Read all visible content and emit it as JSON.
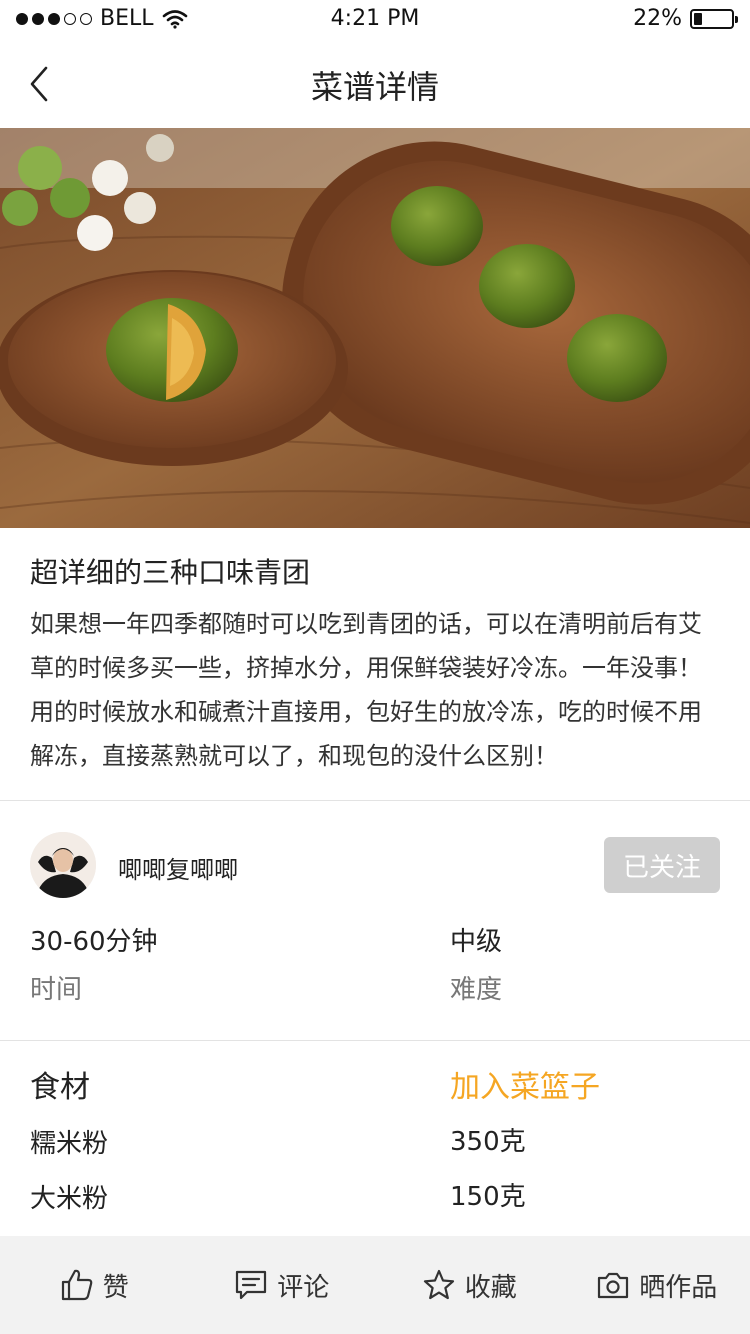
{
  "status_bar": {
    "carrier": "BELL",
    "time": "4:21 PM",
    "battery_percent": "22%",
    "battery_level": 0.22,
    "signal_filled": 3,
    "signal_total": 5
  },
  "navbar": {
    "title": "菜谱详情",
    "back_icon": "chevron-left-icon"
  },
  "recipe": {
    "title": "超详细的三种口味青团",
    "description": "如果想一年四季都随时可以吃到青团的话，可以在清明前后有艾草的时候多买一些，挤掉水分，用保鲜袋装好冷冻。一年没事！用的时候放水和碱煮汁直接用，包好生的放冷冻，吃的时候不用解冻，直接蒸熟就可以了，和现包的没什么区别！"
  },
  "author": {
    "name": "唧唧复唧唧",
    "follow_label": "已关注"
  },
  "meta": {
    "time_value": "30-60分钟",
    "time_label": "时间",
    "difficulty_value": "中级",
    "difficulty_label": "难度"
  },
  "ingredients": {
    "heading": "食材",
    "add_to_basket": "加入菜篮子",
    "items": [
      {
        "name": "糯米粉",
        "amount": "350克"
      },
      {
        "name": "大米粉",
        "amount": "150克"
      }
    ]
  },
  "tabbar": {
    "items": [
      {
        "label": "赞",
        "icon": "thumbs-up-icon"
      },
      {
        "label": "评论",
        "icon": "comment-icon"
      },
      {
        "label": "收藏",
        "icon": "star-icon"
      },
      {
        "label": "晒作品",
        "icon": "camera-icon"
      }
    ]
  },
  "colors": {
    "accent": "#f5a623",
    "follow_bg": "#cfcfcf",
    "tabbar_bg": "#f2f2f2"
  }
}
